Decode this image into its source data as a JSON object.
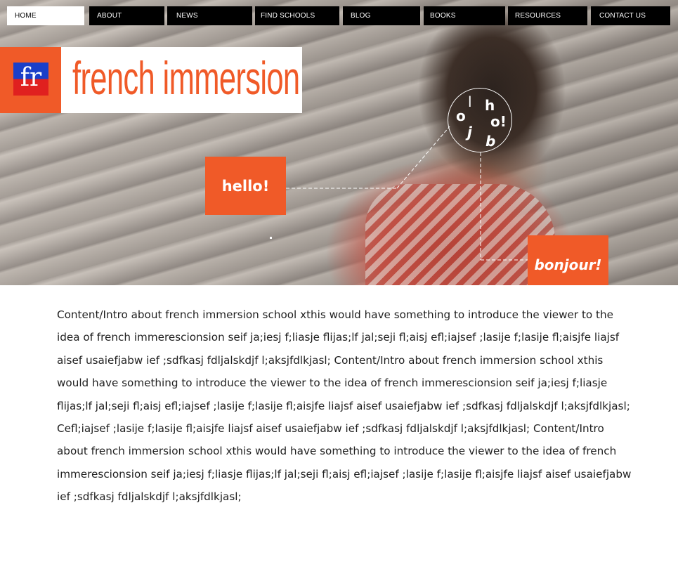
{
  "nav": {
    "items": [
      "HOME",
      "ABOUT",
      "NEWS",
      "FIND SCHOOLS",
      "BLOG",
      "BOOKS",
      "RESOURCES",
      "CONTACT US"
    ],
    "active": "HOME"
  },
  "logo": {
    "badge": "fr",
    "name": "french immersion"
  },
  "hero": {
    "hello": "hello!",
    "bonjour": "bonjour!",
    "letters": [
      "o",
      "l",
      "h",
      "j",
      "o!",
      "b"
    ]
  },
  "intro": {
    "text": "Content/Intro about french immersion school xthis would have something to introduce the viewer to the idea of french immerescionsion seif ja;iesj f;liasje flijas;lf jal;seji fl;aisj efl;iajsef ;lasije f;lasije fl;aisjfe liajsf aisef usaiefjabw ief ;sdfkasj fdljalskdjf l;aksjfdlkjasl; Content/Intro about french immersion school xthis would have something to introduce the viewer to the idea of french immerescionsion seif ja;iesj f;liasje flijas;lf jal;seji fl;aisj efl;iajsef ;lasije f;lasije fl;aisjfe liajsf aisef usaiefjabw ief ;sdfkasj fdljalskdjf l;aksjfdlkjasl; Cefl;iajsef ;lasije f;lasije fl;aisjfe liajsf aisef usaiefjabw ief ;sdfkasj fdljalskdjf l;aksjfdlkjasl; Content/Intro about french immersion school xthis would have something to introduce the viewer to the idea of french immerescionsion seif ja;iesj f;liasje flijas;lf jal;seji fl;aisj efl;iajsef ;lasije f;lasije fl;aisjfe liajsf aisef usaiefjabw ief ;sdfkasj fdljalskdjf l;aksjfdlkjasl;"
  },
  "colors": {
    "accent": "#f05a28",
    "nav_bg": "#000000",
    "nav_text": "#ffffff",
    "flag_blue": "#1a3fc9",
    "flag_red": "#e0201f"
  }
}
